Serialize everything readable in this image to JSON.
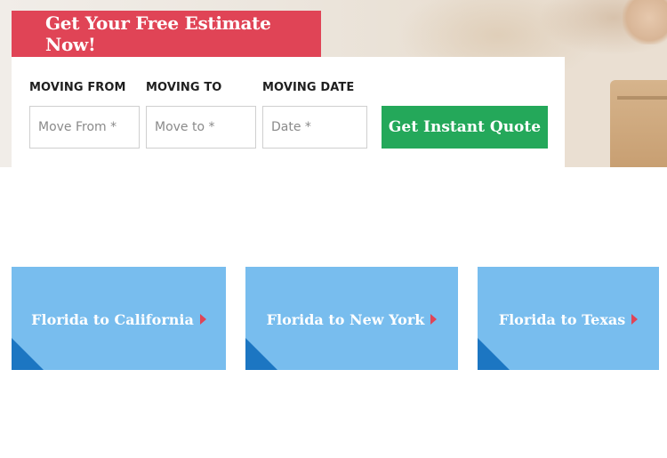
{
  "estimate_tab": {
    "title": "Get Your Free Estimate Now!"
  },
  "form": {
    "fields": [
      {
        "label": "MOVING FROM",
        "placeholder": "Move From *",
        "value": ""
      },
      {
        "label": "MOVING TO",
        "placeholder": "Move to *",
        "value": ""
      },
      {
        "label": "MOVING DATE",
        "placeholder": "Date *",
        "value": ""
      }
    ],
    "submit_label": "Get Instant Quote"
  },
  "routes": [
    {
      "label": "Florida to California",
      "icon": "chevron-right-icon"
    },
    {
      "label": "Florida to New York",
      "icon": "chevron-right-icon"
    },
    {
      "label": "Florida to Texas",
      "icon": "chevron-right-icon"
    }
  ],
  "colors": {
    "estimate_tab_bg": "#e04456",
    "quote_button_bg": "#24a85a",
    "route_card_bg": "#78bdee",
    "route_card_corner": "#1c76c2",
    "arrow": "#e04456"
  }
}
